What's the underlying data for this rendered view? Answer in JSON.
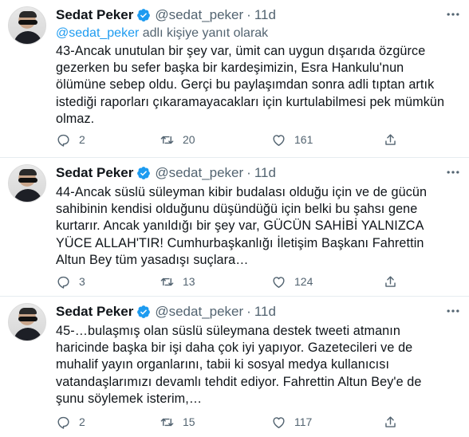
{
  "colors": {
    "accent": "#1d9bf0",
    "text": "#0f1419",
    "muted": "#536471",
    "divider": "#e6ecf0"
  },
  "icons": {
    "verified": "verified-badge-icon",
    "more": "more-icon",
    "reply": "reply-icon",
    "retweet": "retweet-icon",
    "like": "like-icon",
    "share": "share-icon"
  },
  "tweets": [
    {
      "name": "Sedat Peker",
      "handle": "@sedat_peker",
      "dot": "·",
      "time": "11d",
      "replying_mention": "@sedat_peker",
      "replying_suffix": " adlı kişiye yanıt olarak",
      "text": "43-Ancak unutulan bir şey var, ümit can uygun dışarıda özgürce\ngezerken bu sefer başka bir kardeşimizin, Esra Hankulu'nun\nölümüne sebep oldu. Gerçi bu paylaşımdan sonra adli tıptan artık\nistediği raporları çıkaramayacakları için kurtulabilmesi pek mümkün\nolmaz.",
      "replies": "2",
      "retweets": "20",
      "likes": "161"
    },
    {
      "name": "Sedat Peker",
      "handle": "@sedat_peker",
      "dot": "·",
      "time": "11d",
      "text": "44-Ancak süslü süleyman kibir budalası olduğu için ve de gücün\nsahibinin kendisi olduğunu düşündüğü için belki bu şahsı gene\nkurtarır. Ancak yanıldığı bir şey var, GÜCÜN SAHİBİ YALNIZCA\nYÜCE ALLAH'TIR! Cumhurbaşkanlığı İletişim Başkanı Fahrettin\nAltun Bey tüm yasadışı suçlara…",
      "replies": "3",
      "retweets": "13",
      "likes": "124"
    },
    {
      "name": "Sedat Peker",
      "handle": "@sedat_peker",
      "dot": "·",
      "time": "11d",
      "text": "45-…bulaşmış olan süslü süleymana destek tweeti atmanın\nharicinde başka bir işi daha çok iyi yapıyor. Gazetecileri ve de\nmuhalif yayın organlarını, tabii ki sosyal medya kullanıcısı\nvatandaşlarımızı devamlı tehdit ediyor. Fahrettin Altun Bey'e de\nşunu söylemek isterim,…",
      "replies": "2",
      "retweets": "15",
      "likes": "117"
    }
  ]
}
